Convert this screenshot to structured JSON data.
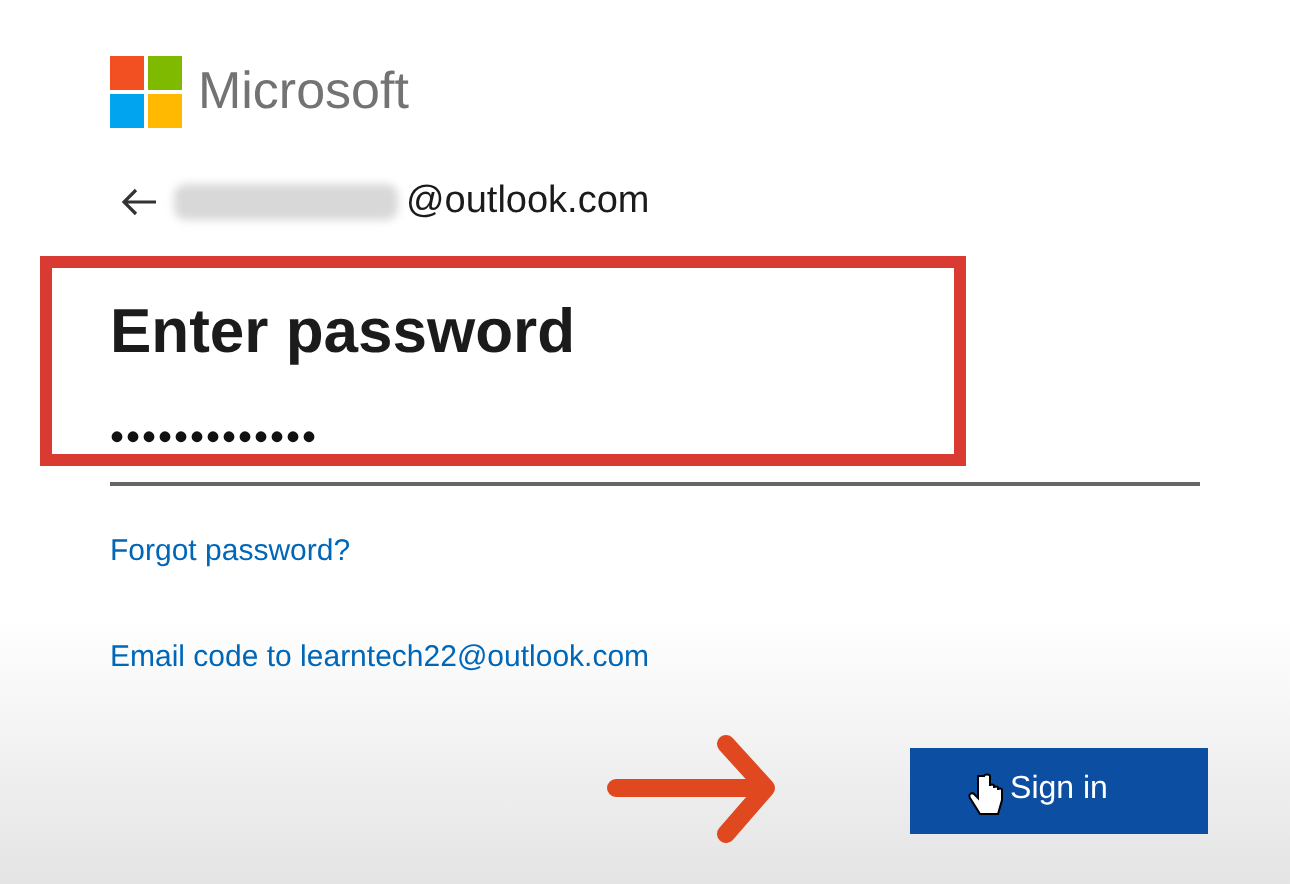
{
  "brand": {
    "name": "Microsoft"
  },
  "account": {
    "email": "@outlook.com",
    "blurred": true
  },
  "heading": "Enter password",
  "password_field": {
    "value": "•••••••••••••"
  },
  "links": [
    "Forgot password?",
    "Email code to learntech22@outlook.com"
  ],
  "primary_button": {
    "label": "Sign in"
  }
}
